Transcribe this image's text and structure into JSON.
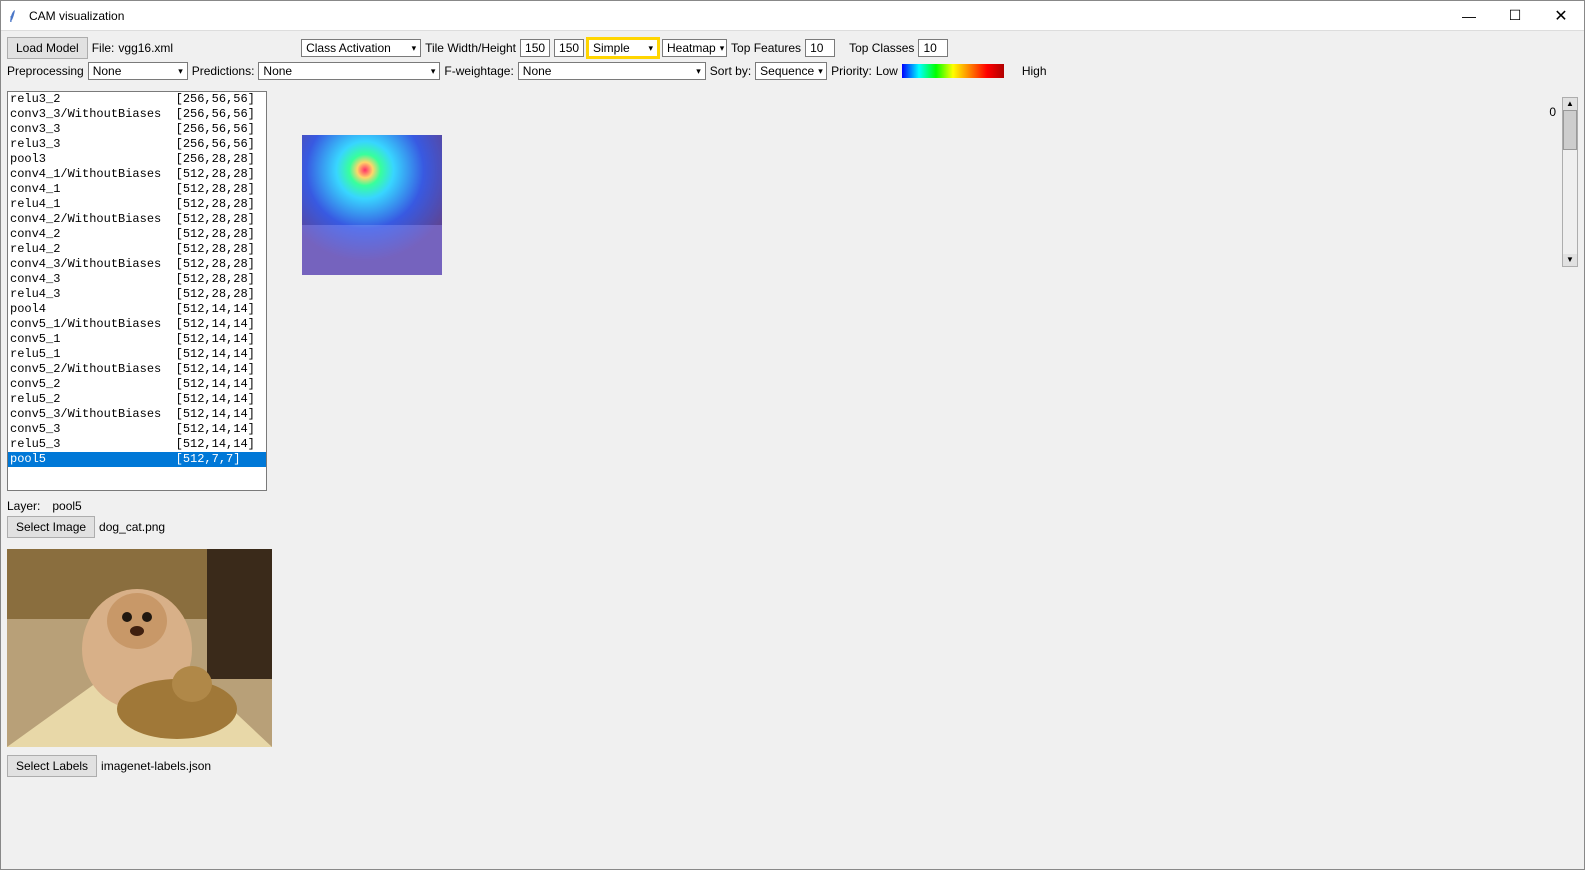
{
  "window": {
    "title": "CAM visualization"
  },
  "toolbar1": {
    "load_model": "Load Model",
    "file_label": "File:",
    "file_value": "vgg16.xml",
    "mode": "Class Activation",
    "tile_label": "Tile Width/Height",
    "tile_w": "150",
    "tile_h": "150",
    "simple": "Simple",
    "heatmap": "Heatmap",
    "top_feat_label": "Top Features",
    "top_feat": "10",
    "top_cls_label": "Top Classes",
    "top_cls": "10"
  },
  "toolbar2": {
    "preproc_label": "Preprocessing",
    "preproc": "None",
    "pred_label": "Predictions:",
    "pred": "None",
    "fw_label": "F-weightage:",
    "fw": "None",
    "sort_label": "Sort by:",
    "sort": "Sequence",
    "priority_label": "Priority:",
    "low": "Low",
    "high": "High"
  },
  "scroll_value": "0",
  "layers": [
    {
      "name": "relu3_2",
      "shape": "[256,56,56]"
    },
    {
      "name": "conv3_3/WithoutBiases",
      "shape": "[256,56,56]"
    },
    {
      "name": "conv3_3",
      "shape": "[256,56,56]"
    },
    {
      "name": "relu3_3",
      "shape": "[256,56,56]"
    },
    {
      "name": "pool3",
      "shape": "[256,28,28]"
    },
    {
      "name": "conv4_1/WithoutBiases",
      "shape": "[512,28,28]"
    },
    {
      "name": "conv4_1",
      "shape": "[512,28,28]"
    },
    {
      "name": "relu4_1",
      "shape": "[512,28,28]"
    },
    {
      "name": "conv4_2/WithoutBiases",
      "shape": "[512,28,28]"
    },
    {
      "name": "conv4_2",
      "shape": "[512,28,28]"
    },
    {
      "name": "relu4_2",
      "shape": "[512,28,28]"
    },
    {
      "name": "conv4_3/WithoutBiases",
      "shape": "[512,28,28]"
    },
    {
      "name": "conv4_3",
      "shape": "[512,28,28]"
    },
    {
      "name": "relu4_3",
      "shape": "[512,28,28]"
    },
    {
      "name": "pool4",
      "shape": "[512,14,14]"
    },
    {
      "name": "conv5_1/WithoutBiases",
      "shape": "[512,14,14]"
    },
    {
      "name": "conv5_1",
      "shape": "[512,14,14]"
    },
    {
      "name": "relu5_1",
      "shape": "[512,14,14]"
    },
    {
      "name": "conv5_2/WithoutBiases",
      "shape": "[512,14,14]"
    },
    {
      "name": "conv5_2",
      "shape": "[512,14,14]"
    },
    {
      "name": "relu5_2",
      "shape": "[512,14,14]"
    },
    {
      "name": "conv5_3/WithoutBiases",
      "shape": "[512,14,14]"
    },
    {
      "name": "conv5_3",
      "shape": "[512,14,14]"
    },
    {
      "name": "relu5_3",
      "shape": "[512,14,14]"
    },
    {
      "name": "pool5",
      "shape": "[512,7,7]",
      "selected": true
    }
  ],
  "layer_label": "Layer:",
  "layer_value": "pool5",
  "select_image": "Select Image",
  "image_file": "dog_cat.png",
  "select_labels": "Select Labels",
  "labels_file": "imagenet-labels.json"
}
